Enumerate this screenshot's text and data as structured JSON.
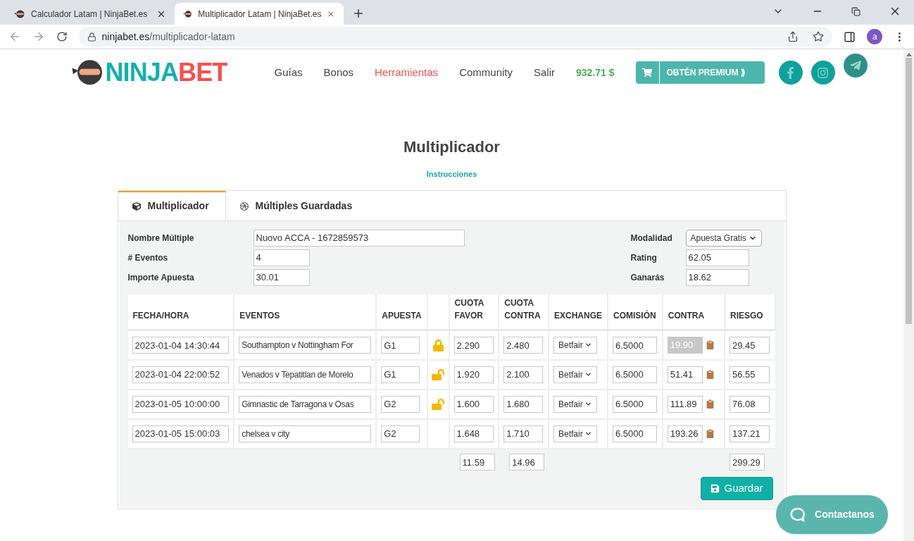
{
  "browser": {
    "tabs": [
      {
        "title": "Calculador Latam | NinjaBet.es",
        "selected": false
      },
      {
        "title": "Multiplicador Latam | NinjaBet.es",
        "selected": true
      }
    ],
    "url_host": "ninjabet.es",
    "url_path": "/multiplicador-latam",
    "profile": "a"
  },
  "header": {
    "logo": [
      "NINJA",
      "BET"
    ],
    "nav": [
      {
        "label": "Guías",
        "selected": false
      },
      {
        "label": "Bonos",
        "selected": false
      },
      {
        "label": "Herramientas",
        "selected": true
      },
      {
        "label": "Community",
        "selected": false
      },
      {
        "label": "Salir",
        "selected": false
      }
    ],
    "balance": "932.71 $",
    "premium": "OBTÉN PREMIUM ⟫"
  },
  "title": "Multiplicador",
  "instructions": "Instrucciones",
  "panel_tabs": [
    {
      "label": "Multiplicador",
      "selected": true
    },
    {
      "label": "Múltiples Guardadas",
      "selected": false
    }
  ],
  "form_left": [
    {
      "label": "Nombre Múltiple",
      "value": "Nuovo ACCA - 1672859573"
    },
    {
      "label": "# Eventos",
      "value": "4"
    },
    {
      "label": "Importe Apuesta",
      "value": "30.01"
    }
  ],
  "form_right": [
    {
      "label": "Modalidad",
      "value": "Apuesta Gratis",
      "kind": "select"
    },
    {
      "label": "Rating",
      "value": "62.05",
      "kind": "input"
    },
    {
      "label": "Ganarás",
      "value": "18.62",
      "kind": "input"
    }
  ],
  "table": {
    "columns": [
      "FECHA/HORA",
      "EVENTOS",
      "APUESTA",
      "CUOTA FAVOR",
      "CUOTA CONTRA",
      "EXCHANGE",
      "COMISIÓN",
      "CONTRA",
      "RIESGO"
    ],
    "rows": [
      {
        "fecha": "2023-01-04 14:30:44",
        "evento": "Southampton v Nottingham For",
        "apuesta": "G1",
        "locked": true,
        "cuota_favor": "2.290",
        "cuota_contra": "2.480",
        "exchange": "Betfair",
        "comision": "6.5000",
        "contra": "19.90",
        "contra_disabled": true,
        "riesgo": "29.45"
      },
      {
        "fecha": "2023-01-04 22:00:52",
        "evento": "Venados v Tepatitlan de Morelo",
        "apuesta": "G1",
        "locked": false,
        "cuota_favor": "1.920",
        "cuota_contra": "2.100",
        "exchange": "Betfair",
        "comision": "6.5000",
        "contra": "51.41",
        "contra_disabled": false,
        "riesgo": "56.55"
      },
      {
        "fecha": "2023-01-05 10:00:00",
        "evento": "Gimnastic de Tarragona v Osas",
        "apuesta": "G2",
        "locked": false,
        "cuota_favor": "1.600",
        "cuota_contra": "1.680",
        "exchange": "Betfair",
        "comision": "6.5000",
        "contra": "111.89",
        "contra_disabled": false,
        "riesgo": "76.08"
      },
      {
        "fecha": "2023-01-05 15:00:03",
        "evento": "chelsea v city",
        "apuesta": "G2",
        "cuota_favor": "1.648",
        "cuota_contra": "1.710",
        "exchange": "Betfair",
        "comision": "6.5000",
        "contra": "193.26",
        "contra_disabled": false,
        "riesgo": "137.21"
      }
    ],
    "totals": {
      "cuota_favor": "11.59",
      "cuota_contra": "14.96",
      "riesgo": "299.29"
    }
  },
  "save": "Guardar",
  "contact": "Contactanos"
}
